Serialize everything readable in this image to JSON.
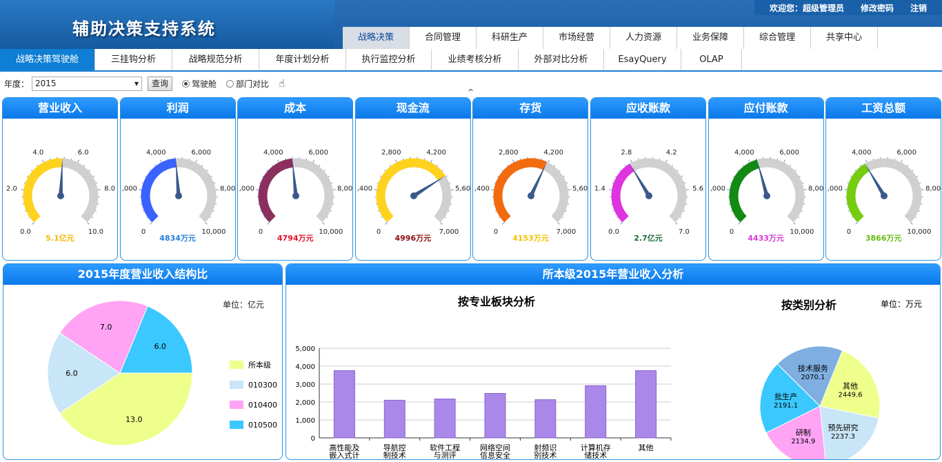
{
  "header": {
    "title": "辅助决策支持系统",
    "welcome": "欢迎您：超级管理员",
    "change_pwd": "修改密码",
    "logout": "注销"
  },
  "main_tabs": [
    "战略决策",
    "合同管理",
    "科研生产",
    "市场经营",
    "人力资源",
    "业务保障",
    "综合管理",
    "共享中心"
  ],
  "sub_tabs": [
    "战略决策驾驶舱",
    "三挂钩分析",
    "战略规范分析",
    "年度计划分析",
    "执行监控分析",
    "业绩考核分析",
    "外部对比分析",
    "EsayQuery",
    "OLAP"
  ],
  "filter": {
    "year_label": "年度：",
    "year_value": "2015",
    "query_button": "查询",
    "radio_cockpit": "驾驶舱",
    "radio_dept": "部门对比"
  },
  "gauges": [
    {
      "title": "营业收入",
      "ticks": [
        "0.0",
        "2.0",
        "4.0",
        "6.0",
        "8.0",
        "10.0"
      ],
      "min": 0,
      "max": 10,
      "value": 5.1,
      "display": "5.1亿元",
      "color": "#ffd21e",
      "textcolor": "#f2b700"
    },
    {
      "title": "利润",
      "ticks": [
        "0",
        ",000",
        "4,000",
        "6,000",
        "8,00",
        "10,000"
      ],
      "min": 0,
      "max": 10000,
      "value": 4834,
      "display": "4834万元",
      "color": "#3a62ff",
      "textcolor": "#2a7fd8"
    },
    {
      "title": "成本",
      "ticks": [
        "0",
        ",000",
        "4,000",
        "6,000",
        "8,00",
        "10,000"
      ],
      "min": 0,
      "max": 10000,
      "value": 4794,
      "display": "4794万元",
      "color": "#8b2f5e",
      "textcolor": "#e0102a"
    },
    {
      "title": "现金流",
      "ticks": [
        "0",
        ",400",
        "2,800",
        "4,200",
        "5,60",
        "7,000"
      ],
      "min": 0,
      "max": 7000,
      "value": 4996,
      "display": "4996万元",
      "color": "#ffd21e",
      "textcolor": "#8b0f12"
    },
    {
      "title": "存货",
      "ticks": [
        "0",
        ",400",
        "2,800",
        "4,200",
        "5,60",
        "7,000"
      ],
      "min": 0,
      "max": 7000,
      "value": 4153,
      "display": "4153万元",
      "color": "#f26b0f",
      "textcolor": "#f2c200"
    },
    {
      "title": "应收账款",
      "ticks": [
        "0.0",
        "1.4",
        "2.8",
        "4.2",
        "5.6",
        "7.0"
      ],
      "min": 0,
      "max": 7,
      "value": 2.7,
      "display": "2.7亿元",
      "color": "#e033e0",
      "textcolor": "#1a6e3a"
    },
    {
      "title": "应付账款",
      "ticks": [
        "0",
        ",000",
        "4,000",
        "6,000",
        "8,00",
        "10,000"
      ],
      "min": 0,
      "max": 10000,
      "value": 4433,
      "display": "4433万元",
      "color": "#138a13",
      "textcolor": "#d23ad2"
    },
    {
      "title": "工资总额",
      "ticks": [
        "0",
        ",000",
        "4,000",
        "6,000",
        "8,00",
        "10,000"
      ],
      "min": 0,
      "max": 10000,
      "value": 3866,
      "display": "3866万元",
      "color": "#77cc10",
      "textcolor": "#66bb10"
    }
  ],
  "panel_left": {
    "title": "2015年度营业收入结构比",
    "unit": "单位：亿元"
  },
  "panel_right": {
    "title": "所本级2015年营业收入分析",
    "bar_title": "按专业板块分析",
    "pie_title": "按类别分析",
    "unit": "单位：万元"
  },
  "chart_data": [
    {
      "type": "pie",
      "legend": [
        "所本级",
        "010300",
        "010400",
        "010500"
      ],
      "values": [
        13.0,
        6.0,
        7.0,
        6.0
      ],
      "labels": [
        "13.0",
        "6.0",
        "7.0",
        "6.0"
      ],
      "colors": [
        "#eeff8c",
        "#c8e6f8",
        "#ffa3f5",
        "#3ac8ff"
      ]
    },
    {
      "type": "bar",
      "title": "按专业板块分析",
      "categories": [
        "高性能及\n嵌入式计\n算机技术",
        "导航控\n制技术",
        "软件工程\n与测评",
        "网络空间\n信息安全\n对抗技术",
        "射频识\n别技术",
        "计算机存\n储技术",
        "其他"
      ],
      "values": [
        3750,
        2100,
        2170,
        2480,
        2130,
        2910,
        3750
      ],
      "ylim": [
        0,
        5000
      ],
      "yticks": [
        "0",
        "1,000",
        "2,000",
        "3,000",
        "4,000",
        "5,000"
      ],
      "color": "#aa88ea"
    },
    {
      "type": "pie",
      "title": "按类别分析",
      "labels": [
        "其他",
        "预先研究",
        "研制",
        "批生产",
        "技术服务"
      ],
      "values": [
        2449.6,
        2237.3,
        2134.9,
        2191.1,
        2070.1
      ],
      "value_labels": [
        "2449.6",
        "2237.3",
        "2134.9",
        "2191.1",
        "2070.1"
      ],
      "colors": [
        "#eeff8c",
        "#c8e6f8",
        "#ffa3f5",
        "#3ac8ff",
        "#7fafe0"
      ]
    }
  ]
}
